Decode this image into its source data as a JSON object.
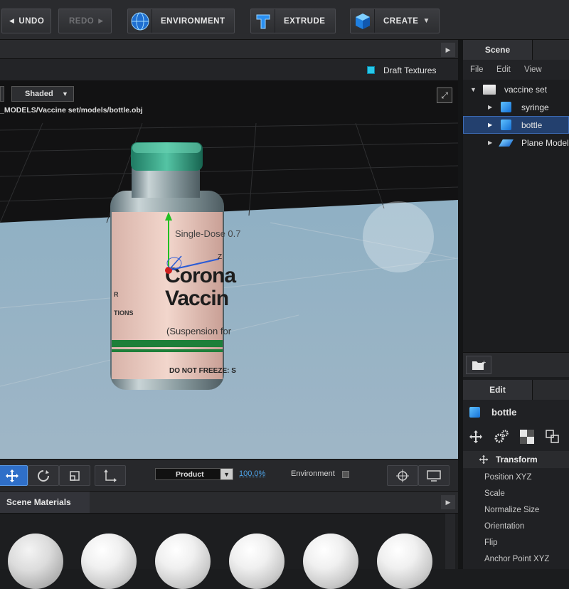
{
  "toolbar": {
    "undo_label": "UNDO",
    "redo_label": "REDO",
    "environment_label": "ENVIRONMENT",
    "extrude_label": "EXTRUDE",
    "create_label": "CREATE"
  },
  "viewport": {
    "draft_textures_label": "Draft Textures",
    "shading_mode": "Shaded",
    "file_path": "_MODELS/Vaccine set/models/bottle.obj",
    "bottle_label": {
      "line1": "Single-Dose 0.7",
      "line2": "Corona",
      "line3": "Vaccin",
      "line4": "(Suspension for",
      "line5": "DO NOT FREEZE: S",
      "side1": "R",
      "side2": "TIONS"
    },
    "gizmo_axis_z": "Z"
  },
  "viewport_bottom": {
    "camera_mode": "Product",
    "zoom": "100.0%",
    "environment_label": "Environment"
  },
  "materials": {
    "header": "Scene Materials"
  },
  "scene": {
    "tab_label": "Scene",
    "menu": [
      "File",
      "Edit",
      "View"
    ],
    "root": "vaccine set",
    "items": [
      "syringe",
      "bottle",
      "Plane Model"
    ]
  },
  "edit": {
    "tab_label": "Edit",
    "object_name": "bottle",
    "section": "Transform",
    "properties": [
      "Position XYZ",
      "Scale",
      "Normalize Size",
      "Orientation",
      "Flip",
      "Anchor Point XYZ"
    ]
  },
  "colors": {
    "accent": "#3d8bd8",
    "selection": "#23406e",
    "zoom_link": "#4da3e8"
  }
}
